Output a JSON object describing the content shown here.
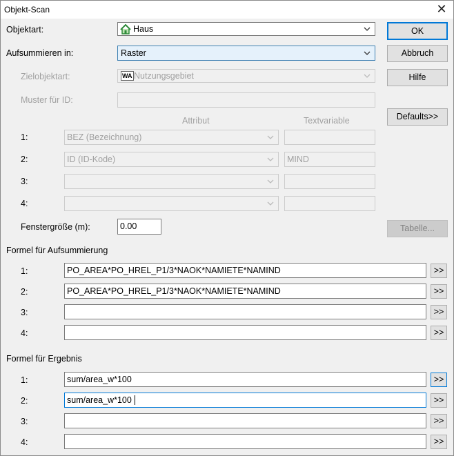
{
  "window": {
    "title": "Objekt-Scan"
  },
  "labels": {
    "objektart": "Objektart:",
    "aufsummieren": "Aufsummieren in:",
    "zielobjektart": "Zielobjektart:",
    "muster": "Muster für ID:",
    "attribut_header": "Attribut",
    "textvariable_header": "Textvariable",
    "fenstergroesse": "Fenstergröße (m):",
    "formel_aufsummierung": "Formel für Aufsummierung",
    "formel_ergebnis": "Formel für Ergebnis"
  },
  "objektart": {
    "value": "Haus",
    "icon": "house-icon"
  },
  "aufsummieren": {
    "value": "Raster"
  },
  "zielobjektart": {
    "value": "Nutzungsgebiet",
    "icon_text": "WA"
  },
  "muster": {
    "value": ""
  },
  "fenstergroesse": {
    "value": "0.00"
  },
  "attribute_rows": [
    {
      "num": "1:",
      "attribut": "BEZ (Bezeichnung)",
      "textvariable": ""
    },
    {
      "num": "2:",
      "attribut": "ID (ID-Kode)",
      "textvariable": "MIND"
    },
    {
      "num": "3:",
      "attribut": "",
      "textvariable": ""
    },
    {
      "num": "4:",
      "attribut": "",
      "textvariable": ""
    }
  ],
  "formel_aufsummierung": [
    {
      "num": "1:",
      "value": "PO_AREA*PO_HREL_P1/3*NAOK*NAMIETE*NAMIND"
    },
    {
      "num": "2:",
      "value": "PO_AREA*PO_HREL_P1/3*NAOK*NAMIETE*NAMIND"
    },
    {
      "num": "3:",
      "value": ""
    },
    {
      "num": "4:",
      "value": ""
    }
  ],
  "formel_ergebnis": [
    {
      "num": "1:",
      "value": "sum/area_w*100"
    },
    {
      "num": "2:",
      "value": "sum/area_w*100"
    },
    {
      "num": "3:",
      "value": ""
    },
    {
      "num": "4:",
      "value": ""
    }
  ],
  "buttons": {
    "ok": "OK",
    "abbruch": "Abbruch",
    "hilfe": "Hilfe",
    "defaults": "Defaults>>",
    "tabelle": "Tabelle...",
    "more": ">>"
  },
  "colors": {
    "accent": "#0078d7",
    "dialog_bg": "#f0f0f0",
    "selected_combo": "#e5f1fb",
    "house_green": "#2e8b3a"
  }
}
